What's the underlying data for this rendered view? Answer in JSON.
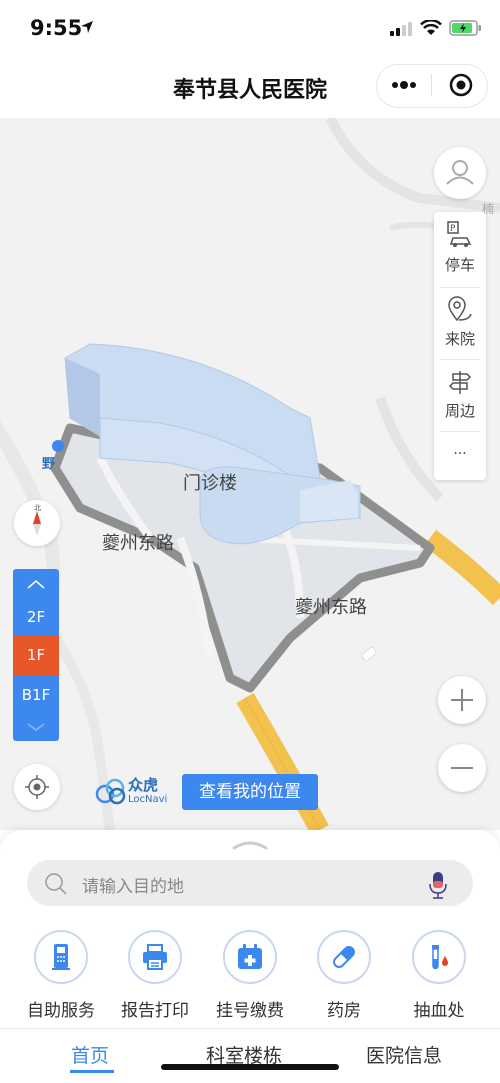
{
  "status_bar": {
    "time": "9:55"
  },
  "title_bar": {
    "title": "奉节县人民医院"
  },
  "map": {
    "building_label": "门诊楼",
    "road_label_1": "夔州东路",
    "road_label_2": "夔州东路",
    "poi_partial": "野",
    "edge_text": "楠"
  },
  "tools": {
    "parking": "停车",
    "to_hospital": "来院",
    "nearby": "周边",
    "more": "..."
  },
  "floors": {
    "current": "1F",
    "items": [
      "2F",
      "1F",
      "B1F"
    ]
  },
  "brand": {
    "name": "众虎",
    "sub": "LocNavi"
  },
  "locate_button": "查看我的位置",
  "search": {
    "placeholder": "请输入目的地"
  },
  "services": [
    {
      "label": "自助服务",
      "icon": "kiosk-icon"
    },
    {
      "label": "报告打印",
      "icon": "printer-icon"
    },
    {
      "label": "挂号缴费",
      "icon": "calendar-medical-icon"
    },
    {
      "label": "药房",
      "icon": "pill-icon"
    },
    {
      "label": "抽血处",
      "icon": "test-tube-icon"
    }
  ],
  "tabs": {
    "home": "首页",
    "departments": "科室楼栋",
    "info": "医院信息"
  },
  "colors": {
    "accent": "#3c88ee",
    "floor_active": "#e8572a",
    "building": "#c6d9f1",
    "road": "#f2c14e"
  }
}
